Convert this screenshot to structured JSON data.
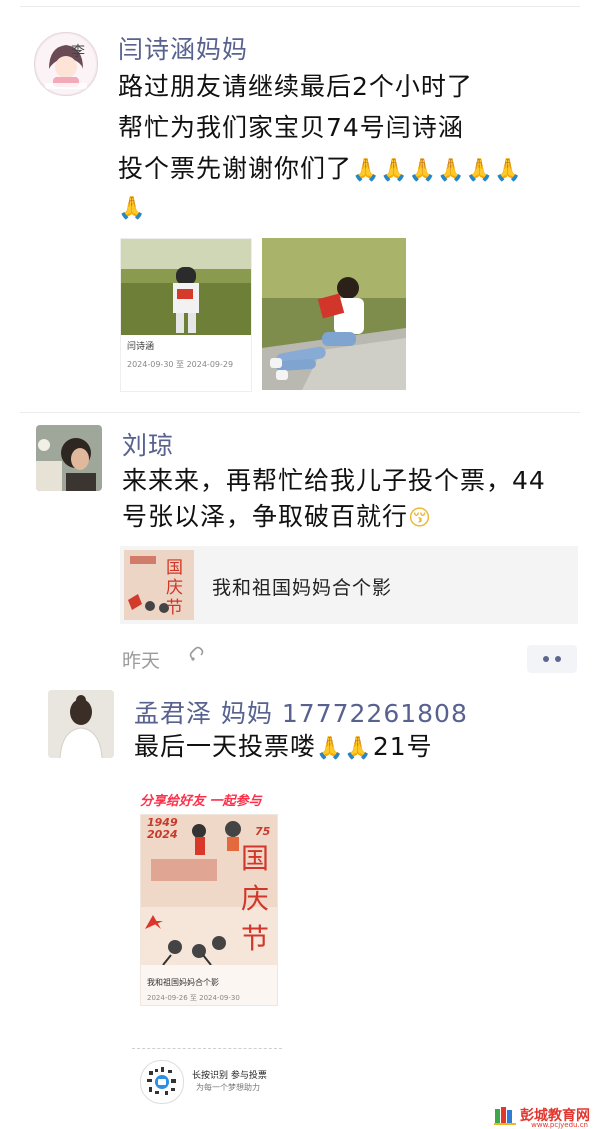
{
  "posts": [
    {
      "author": "闫诗涵妈妈",
      "avatar_label": "李",
      "lines": [
        "路过朋友请继续最后2个小时了",
        "帮忙为我们家宝贝74号闫诗涵",
        "投个票先谢谢你们了"
      ],
      "emoji_row": "🙏🙏🙏🙏🙏🙏",
      "emoji_row2": "🙏",
      "photo1_caption": "闫诗涵",
      "photo1_dates": "2024-09-30 至 2024-09-29"
    },
    {
      "author": "刘琼",
      "lines": [
        "来来来，再帮忙给我儿子投个票，44",
        "号张以泽，争取破百就行"
      ],
      "end_emoji": "😚",
      "link_card": {
        "title": "我和祖国妈妈合个影",
        "thumb_text": "国庆节"
      },
      "time": "昨天"
    },
    {
      "author": "孟君泽 妈妈 17772261808",
      "lines": [
        "最后一天投票喽"
      ],
      "line_suffix": "21号",
      "emoji": "🙏🙏",
      "share_caption": "分享给好友 一起参与",
      "poster": {
        "years": "1949\n2024",
        "number": "75",
        "headline": "国庆节",
        "caption": "我和祖国妈妈合个影",
        "dates": "2024-09-26 至 2024-09-30",
        "qr_label": "长按识别 参与投票",
        "qr_sub": "为每一个梦想助力"
      }
    }
  ],
  "watermark": {
    "name": "彭城教育网",
    "url": "www.pcjyedu.cn"
  },
  "colors": {
    "name": "#57628f",
    "text": "#111111",
    "accent_red": "#e3362e",
    "card_bg": "#f4f4f4"
  }
}
